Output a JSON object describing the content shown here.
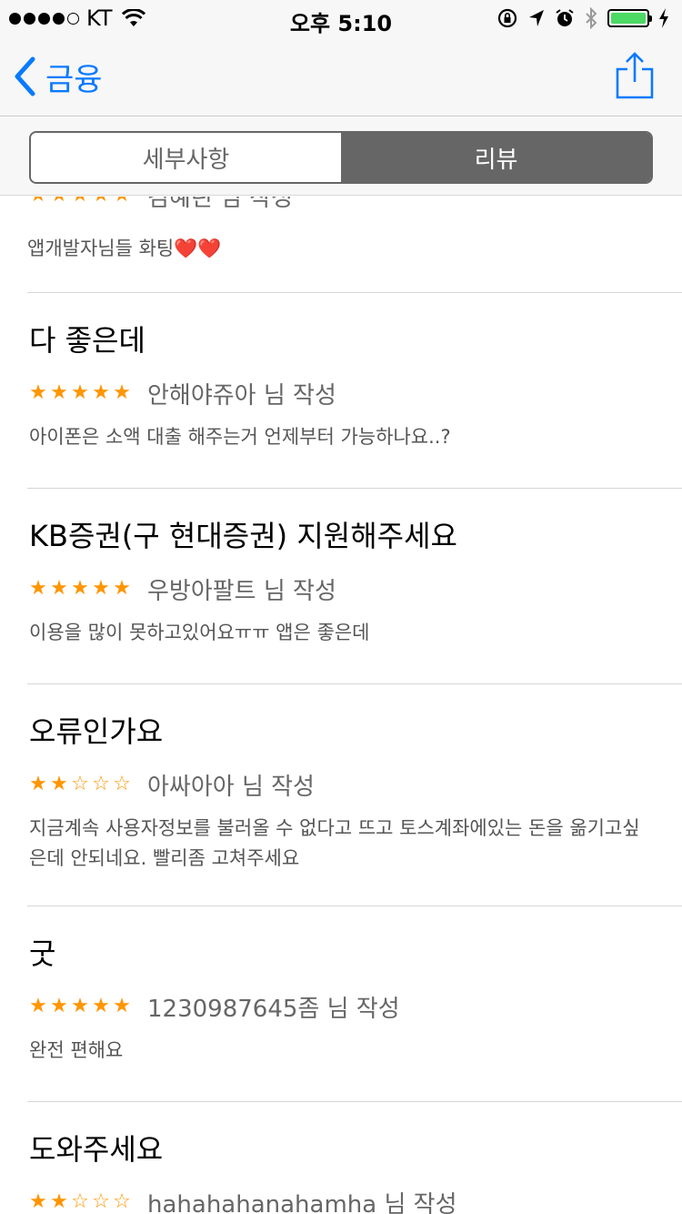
{
  "status": {
    "carrier": "KT",
    "time": "오후 5:10"
  },
  "nav": {
    "back_label": "금융"
  },
  "segments": {
    "details": "세부사항",
    "reviews": "리뷰",
    "selected": "리뷰"
  },
  "reviews": [
    {
      "title": "",
      "stars": 5,
      "author": "김혜린 님 작성",
      "body": "앱개발자님들 화팅",
      "body_emoji": "❤️❤️"
    },
    {
      "title": "다 좋은데",
      "stars": 5,
      "author": "안해야쥬아 님 작성",
      "body": "아이폰은 소액 대출 해주는거 언제부터 가능하나요..?"
    },
    {
      "title": "KB증권(구 현대증권) 지원해주세요",
      "stars": 5,
      "author": "우방아팔트 님 작성",
      "body": "이용을 많이 못하고있어요ㅠㅠ 앱은 좋은데"
    },
    {
      "title": "오류인가요",
      "stars": 2,
      "author": "아싸아아 님 작성",
      "body": "지금계속 사용자정보를 불러올 수 없다고 뜨고 토스계좌에있는 돈을 옮기고싶은데 안되네요. 빨리좀 고쳐주세요"
    },
    {
      "title": "굿",
      "stars": 5,
      "author": "1230987645좀 님 작성",
      "body": "완전 편해요"
    },
    {
      "title": "도와주세요",
      "stars": 2,
      "author": "hahahahanahamha 님 작성",
      "body": ""
    }
  ]
}
